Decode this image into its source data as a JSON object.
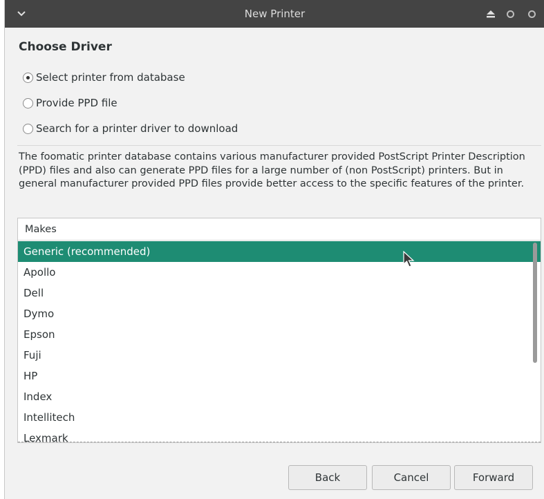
{
  "window": {
    "title": "New Printer"
  },
  "page": {
    "heading": "Choose Driver"
  },
  "radio_options": [
    {
      "label": "Select printer from database",
      "checked": true
    },
    {
      "label": "Provide PPD file",
      "checked": false
    },
    {
      "label": "Search for a printer driver to download",
      "checked": false
    }
  ],
  "description": "The foomatic printer database contains various manufacturer provided PostScript Printer Description (PPD) files and also can generate PPD files for a large number of (non PostScript) printers. But in general manufacturer provided PPD files provide better access to the specific features of the printer.",
  "makes_list": {
    "header": "Makes",
    "items": [
      "Generic (recommended)",
      "Apollo",
      "Dell",
      "Dymo",
      "Epson",
      "Fuji",
      "HP",
      "Index",
      "Intellitech",
      "Lexmark"
    ],
    "selected_index": 0
  },
  "buttons": {
    "back": "Back",
    "cancel": "Cancel",
    "forward": "Forward"
  },
  "colors": {
    "selection": "#1e8c73",
    "titlebar": "#444444"
  },
  "icons": {
    "titlebar_menu": "chevron-down-icon",
    "eject": "eject-icon",
    "minimize": "circle-icon",
    "maximize": "circle-icon",
    "pointer": "mouse-pointer-icon"
  }
}
